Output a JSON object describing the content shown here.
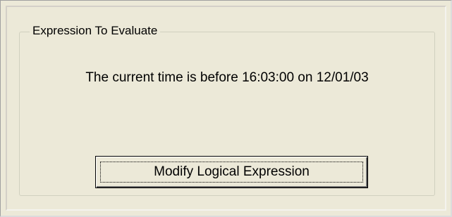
{
  "group": {
    "legend": "Expression To Evaluate"
  },
  "expression": {
    "text": "The current time is before 16:03:00 on 12/01/03"
  },
  "buttons": {
    "modify_label": "Modify Logical Expression"
  },
  "colors": {
    "background": "#ece9d8",
    "text": "#000000"
  }
}
